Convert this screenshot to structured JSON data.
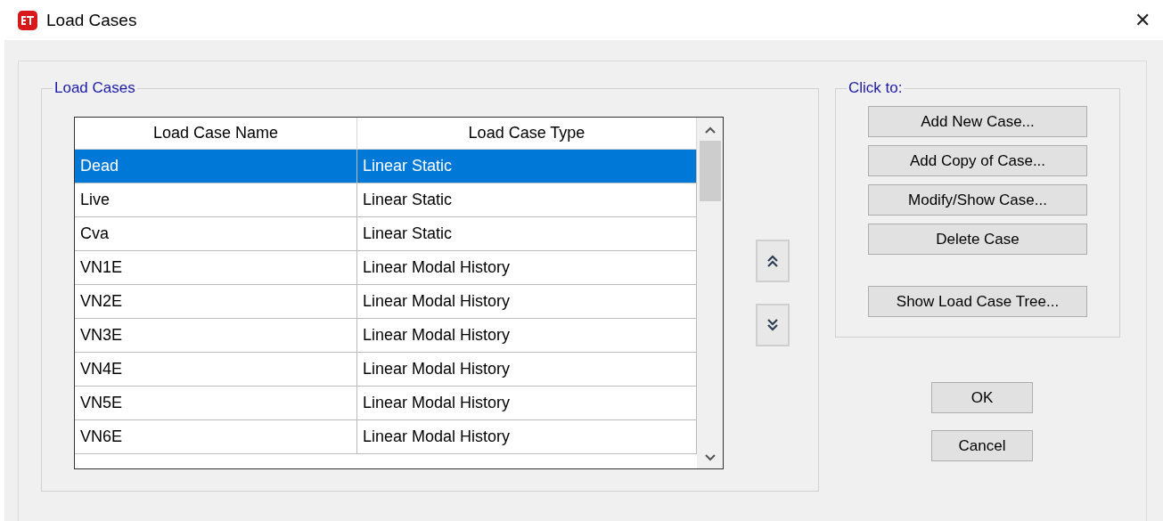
{
  "window": {
    "title": "Load Cases",
    "close": "✕"
  },
  "load_cases": {
    "title": "Load Cases",
    "columns": [
      "Load Case Name",
      "Load Case Type"
    ],
    "rows": [
      {
        "name": "Dead",
        "type": "Linear Static",
        "selected": true
      },
      {
        "name": "Live",
        "type": "Linear Static",
        "selected": false
      },
      {
        "name": "Cva",
        "type": "Linear Static",
        "selected": false
      },
      {
        "name": "VN1E",
        "type": "Linear Modal History",
        "selected": false
      },
      {
        "name": "VN2E",
        "type": "Linear Modal History",
        "selected": false
      },
      {
        "name": "VN3E",
        "type": "Linear Modal History",
        "selected": false
      },
      {
        "name": "VN4E",
        "type": "Linear Modal History",
        "selected": false
      },
      {
        "name": "VN5E",
        "type": "Linear Modal History",
        "selected": false
      },
      {
        "name": "VN6E",
        "type": "Linear Modal History",
        "selected": false
      }
    ]
  },
  "click_to": {
    "title": "Click to:",
    "buttons": [
      "Add New Case...",
      "Add Copy of Case...",
      "Modify/Show Case...",
      "Delete Case"
    ],
    "tree_button": "Show Load Case Tree..."
  },
  "buttons": [
    "OK",
    "Cancel"
  ]
}
